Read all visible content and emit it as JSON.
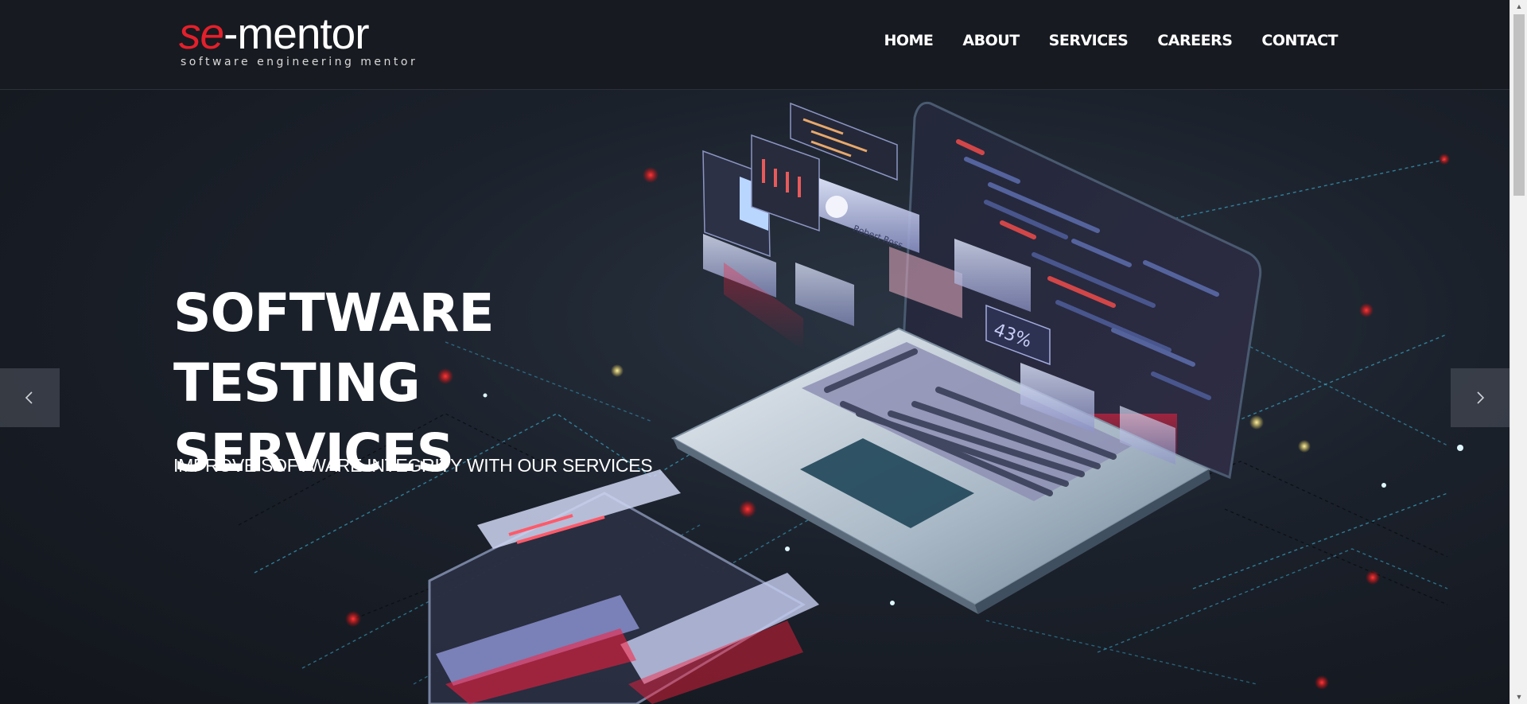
{
  "header": {
    "logo": {
      "se": "se",
      "rest": "-mentor",
      "tagline": "software engineering mentor"
    },
    "nav": [
      {
        "label": "HOME"
      },
      {
        "label": "ABOUT"
      },
      {
        "label": "SERVICES"
      },
      {
        "label": "CAREERS"
      },
      {
        "label": "CONTACT"
      }
    ]
  },
  "hero": {
    "title_line1": "SOFTWARE TESTING",
    "title_line2": "SERVICES",
    "subtitle": "IMPROVE SOFTWARE INTEGRITY WITH OUR SERVICES",
    "illustration": {
      "percent_label": "43%",
      "card_name_label": "Robert Ross"
    },
    "prev_icon": "chevron-left-icon",
    "next_icon": "chevron-right-icon"
  },
  "scrollbar": {
    "up_icon": "triangle-up-icon",
    "down_icon": "triangle-down-icon",
    "up_glyph": "▲",
    "down_glyph": "▼"
  },
  "colors": {
    "brand_red": "#e3202b",
    "header_bg": "#171a20",
    "hero_bg": "#1b212b",
    "accent_cyan": "#3ab0d6",
    "text": "#ffffff"
  }
}
